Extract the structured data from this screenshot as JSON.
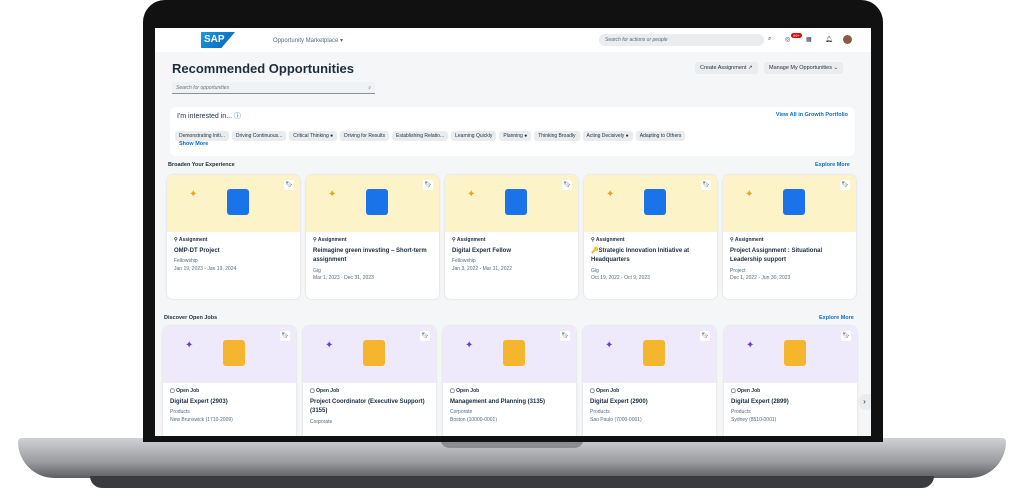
{
  "header": {
    "logo": "SAP",
    "app_menu": "Opportunity Marketplace ▾",
    "search_placeholder": "Search for actions or people",
    "badge": "99+"
  },
  "page": {
    "title": "Recommended Opportunities",
    "search_placeholder": "Search for opportunities",
    "create_button": "Create Assignment ↗",
    "manage_button": "Manage My Opportunities ⌄"
  },
  "interests": {
    "title": "I'm interested in...",
    "view_all": "View All in Growth Portfolio",
    "show_more": "Show More",
    "chips": [
      "Demonstrating Initi...",
      "Driving Continuous...",
      "Critical Thinking ●",
      "Driving for Results",
      "Establishing Relatio...",
      "Learning Quickly",
      "Planning ●",
      "Thinking Broadly",
      "Acting Decisively ●",
      "Adapting to Others"
    ]
  },
  "broaden": {
    "title": "Broaden Your Experience",
    "explore": "Explore More",
    "cards": [
      {
        "kind": "Assignment",
        "name": "OMP-DT Project",
        "type": "Fellowship",
        "dates": "Jan 19, 2023 - Jan 19, 2024"
      },
      {
        "kind": "Assignment",
        "name": "Reimagine green investing – Short-term assignment",
        "type": "Gig",
        "dates": "Mar 1, 2023 - Dec 31, 2023"
      },
      {
        "kind": "Assignment",
        "name": "Digital Expert Fellow",
        "type": "Fellowship",
        "dates": "Jan 3, 2022 - Mar 31, 2022"
      },
      {
        "kind": "Assignment",
        "name": "🔑Strategic Innovation Initiative at Headquarters",
        "type": "Gig",
        "dates": "Oct 19, 2022 - Oct 9, 2023"
      },
      {
        "kind": "Assignment",
        "name": "Project Assignment : Situational Leadership support",
        "type": "Project",
        "dates": "Dec 1, 2022 - Jun 30, 2023"
      }
    ]
  },
  "jobs": {
    "title": "Discover Open Jobs",
    "explore": "Explore More",
    "cards": [
      {
        "kind": "Open Job",
        "name": "Digital Expert (2903)",
        "type": "Products",
        "dates": "New Brunswick (1710-2009)"
      },
      {
        "kind": "Open Job",
        "name": "Project Coordinator (Executive Support) (3155)",
        "type": "Corporate",
        "dates": ""
      },
      {
        "kind": "Open Job",
        "name": "Management and Planning (3135)",
        "type": "Corporate",
        "dates": "Boston (10000-0001)"
      },
      {
        "kind": "Open Job",
        "name": "Digital Expert (2900)",
        "type": "Products",
        "dates": "Sao Paulo (7000-0001)"
      },
      {
        "kind": "Open Job",
        "name": "Digital Expert (2899)",
        "type": "Products",
        "dates": "Sydney (8510-0001)"
      }
    ]
  },
  "colors": {
    "accent": "#0a6ed1",
    "assignment_bg": "#fdf3c8",
    "job_bg": "#efeafb"
  }
}
